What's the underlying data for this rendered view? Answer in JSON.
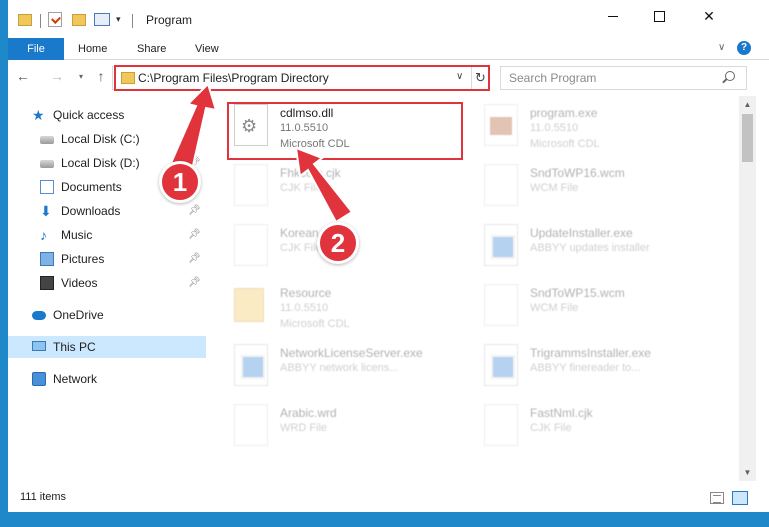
{
  "titlebar": {
    "title": "Program"
  },
  "ribbon": {
    "file": "File",
    "home": "Home",
    "share": "Share",
    "view": "View"
  },
  "address": {
    "path": "C:\\Program Files\\Program Directory"
  },
  "search": {
    "placeholder": "Search Program"
  },
  "sidebar": {
    "items": [
      {
        "label": "Quick access",
        "icon": "star-icon"
      },
      {
        "label": "Local Disk (C:)",
        "icon": "disk-icon"
      },
      {
        "label": "Local Disk (D:)",
        "icon": "disk-icon"
      },
      {
        "label": "Documents",
        "icon": "documents-icon"
      },
      {
        "label": "Downloads",
        "icon": "download-icon"
      },
      {
        "label": "Music",
        "icon": "music-icon"
      },
      {
        "label": "Pictures",
        "icon": "pictures-icon"
      },
      {
        "label": "Videos",
        "icon": "videos-icon"
      },
      {
        "label": "OneDrive",
        "icon": "cloud-icon"
      },
      {
        "label": "This PC",
        "icon": "computer-icon",
        "selected": true
      },
      {
        "label": "Network",
        "icon": "network-icon"
      }
    ]
  },
  "files": [
    {
      "name": "cdlmso.dll",
      "line2": "11.0.5510",
      "line3": "Microsoft CDL",
      "icon": "dll-file-icon"
    },
    {
      "name": "program.exe",
      "line2": "11.0.5510",
      "line3": "Microsoft CDL",
      "icon": "exe-file-icon"
    },
    {
      "name": "Fhkcom.cjk",
      "line2": "CJK File",
      "line3": "",
      "icon": "generic-file-icon"
    },
    {
      "name": "SndToWP16.wcm",
      "line2": "WCM File",
      "line3": "",
      "icon": "generic-file-icon"
    },
    {
      "name": "Korean.cjk",
      "line2": "CJK File",
      "line3": "",
      "icon": "generic-file-icon"
    },
    {
      "name": "UpdateInstaller.exe",
      "line2": "ABBYY updates installer",
      "line3": "",
      "icon": "exe-file-icon"
    },
    {
      "name": "Resource",
      "line2": "11.0.5510",
      "line3": "Microsoft CDL",
      "icon": "folder-file-icon"
    },
    {
      "name": "SndToWP15.wcm",
      "line2": "WCM File",
      "line3": "",
      "icon": "generic-file-icon"
    },
    {
      "name": "NetworkLicenseServer.exe",
      "line2": "ABBYY network licens...",
      "line3": "",
      "icon": "exe-file-icon"
    },
    {
      "name": "TrigrammsInstaller.exe",
      "line2": "ABBYY finereader to...",
      "line3": "",
      "icon": "exe-file-icon"
    },
    {
      "name": "Arabic.wrd",
      "line2": "WRD File",
      "line3": "",
      "icon": "generic-file-icon"
    },
    {
      "name": "FastNml.cjk",
      "line2": "CJK File",
      "line3": "",
      "icon": "generic-file-icon"
    }
  ],
  "status": {
    "count": "111 items"
  },
  "callouts": {
    "one": "1",
    "two": "2"
  },
  "colors": {
    "accent": "#1979ca",
    "highlight": "#e0333c",
    "selected": "#cce8ff"
  }
}
